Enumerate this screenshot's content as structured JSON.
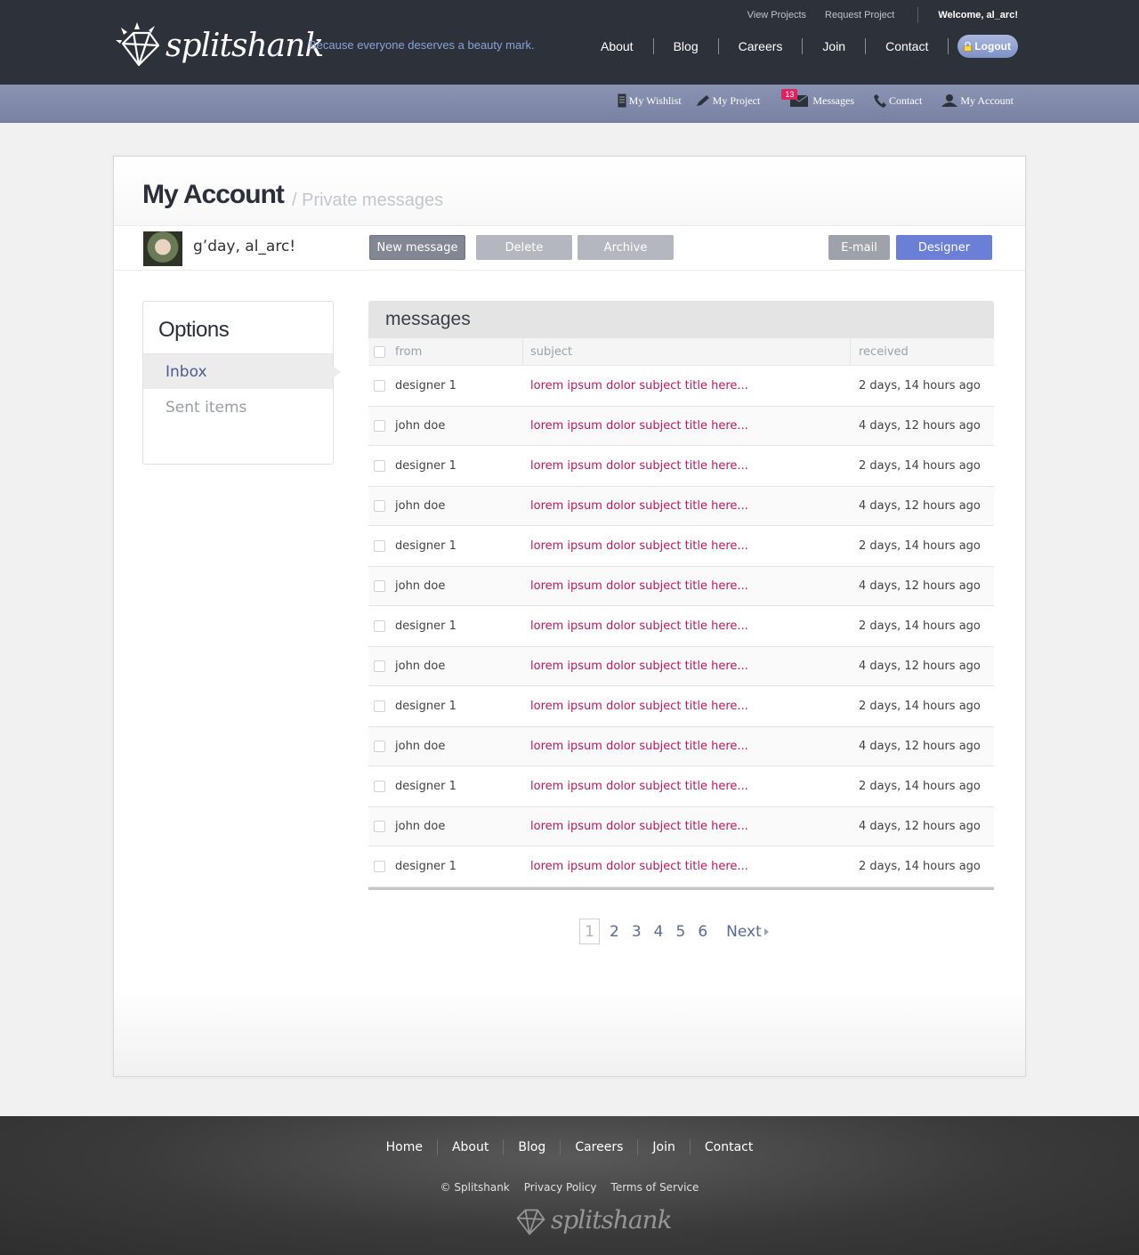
{
  "brand": {
    "name": "splitshank",
    "tagline": "Because everyone deserves a beauty mark."
  },
  "utility": {
    "links": [
      "View Projects",
      "Request Project"
    ],
    "welcome": "Welcome, al_arc!"
  },
  "mainnav": {
    "items": [
      "About",
      "Blog",
      "Careers",
      "Join",
      "Contact"
    ],
    "logout": "Logout"
  },
  "subnav": {
    "wishlist": "My Wishlist",
    "project": "My Project",
    "messages": "Messages",
    "messages_count": "13",
    "contact": "Contact",
    "account": "My Account"
  },
  "page": {
    "title": "My Account",
    "subtitle": "/ Private messages",
    "greeting": "g’day, al_arc!"
  },
  "actions": {
    "new_message": "New message",
    "delete": "Delete",
    "archive": "Archive",
    "email": "E-mail",
    "designer": "Designer"
  },
  "options": {
    "heading": "Options",
    "inbox": "Inbox",
    "sent": "Sent items"
  },
  "messages": {
    "heading": "messages",
    "columns": {
      "from": "from",
      "subject": "subject",
      "received": "received"
    },
    "rows": [
      {
        "from": "designer 1",
        "subject": "lorem ipsum dolor subject title here...",
        "received": "2 days, 14 hours ago"
      },
      {
        "from": "john doe",
        "subject": "lorem ipsum dolor subject title here...",
        "received": "4 days, 12 hours ago"
      },
      {
        "from": "designer 1",
        "subject": "lorem ipsum dolor subject title here...",
        "received": "2 days, 14 hours ago"
      },
      {
        "from": "john doe",
        "subject": "lorem ipsum dolor subject title here...",
        "received": "4 days, 12 hours ago"
      },
      {
        "from": "designer 1",
        "subject": "lorem ipsum dolor subject title here...",
        "received": "2 days, 14 hours ago"
      },
      {
        "from": "john doe",
        "subject": "lorem ipsum dolor subject title here...",
        "received": "4 days, 12 hours ago"
      },
      {
        "from": "designer 1",
        "subject": "lorem ipsum dolor subject title here...",
        "received": "2 days, 14 hours ago"
      },
      {
        "from": "john doe",
        "subject": "lorem ipsum dolor subject title here...",
        "received": "4 days, 12 hours ago"
      },
      {
        "from": "designer 1",
        "subject": "lorem ipsum dolor subject title here...",
        "received": "2 days, 14 hours ago"
      },
      {
        "from": "john doe",
        "subject": "lorem ipsum dolor subject title here...",
        "received": "4 days, 12 hours ago"
      },
      {
        "from": "designer 1",
        "subject": "lorem ipsum dolor subject title here...",
        "received": "2 days, 14 hours ago"
      },
      {
        "from": "john doe",
        "subject": "lorem ipsum dolor subject title here...",
        "received": "4 days, 12 hours ago"
      },
      {
        "from": "designer 1",
        "subject": "lorem ipsum dolor subject title here...",
        "received": "2 days, 14 hours ago"
      }
    ]
  },
  "pagination": {
    "current": "1",
    "pages": [
      "2",
      "3",
      "4",
      "5",
      "6"
    ],
    "next": "Next"
  },
  "footer": {
    "nav": [
      "Home",
      "About",
      "Blog",
      "Careers",
      "Join",
      "Contact"
    ],
    "copyright": "© Splitshank",
    "privacy": "Privacy Policy",
    "terms": "Terms of Service",
    "logo_text": "splitshank"
  },
  "colors": {
    "topbar": "#2c313a",
    "subbar": "#7f87a9",
    "accent": "#6b7fd6",
    "subject": "#c2185b",
    "badge": "#e0235f"
  }
}
